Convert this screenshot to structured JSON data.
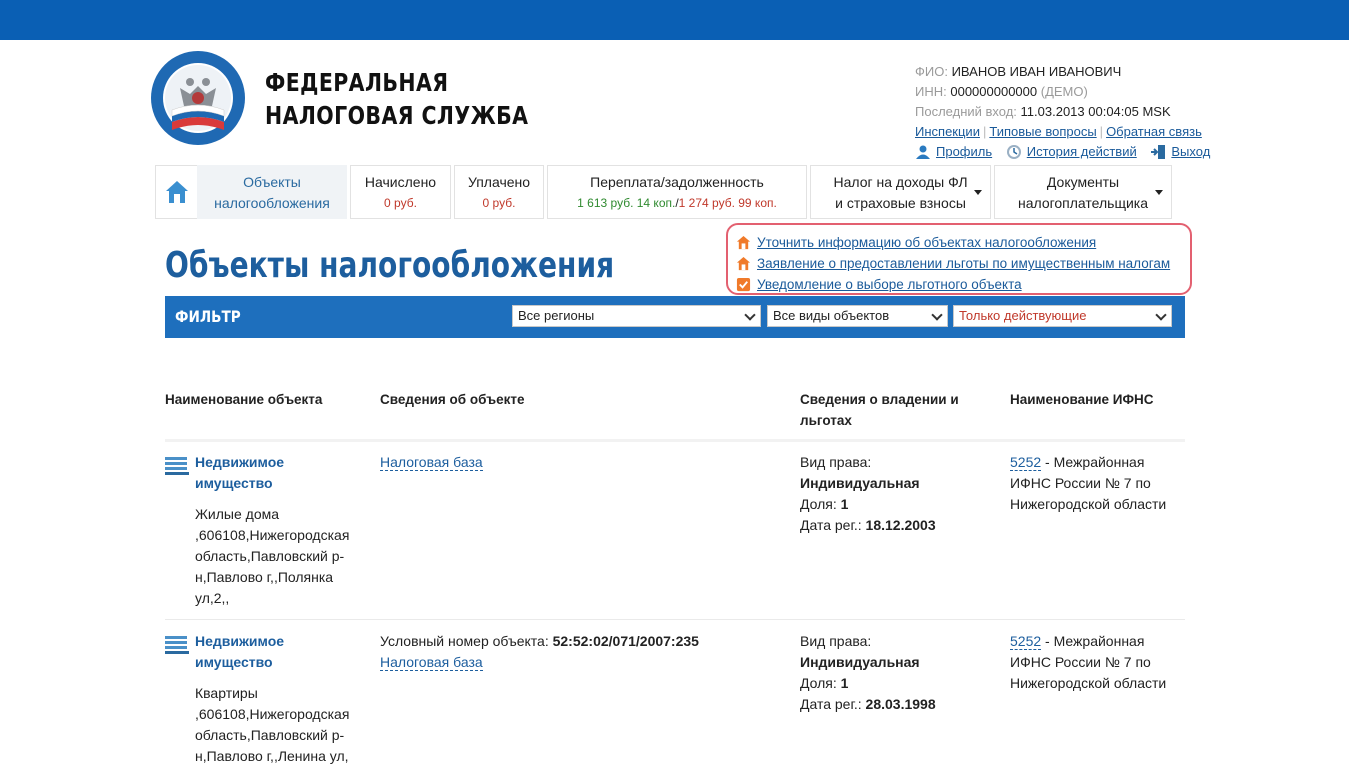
{
  "brand": {
    "line1": "ФЕДЕРАЛЬНАЯ",
    "line2": "НАЛОГОВАЯ СЛУЖБА",
    "logo_text": "ФЕДЕРАЛЬНАЯ НАЛОГОВАЯ СЛУЖБА"
  },
  "user": {
    "fio_label": "ФИО:",
    "fio": "ИВАНОВ ИВАН ИВАНОВИЧ",
    "inn_label": "ИНН:",
    "inn": "000000000000",
    "inn_note": "(ДЕМО)",
    "last_login_label": "Последний вход:",
    "last_login": "11.03.2013 00:04:05 MSK",
    "links": [
      "Инспекции",
      "Типовые вопросы",
      "Обратная связь"
    ],
    "profile": "Профиль",
    "history": "История действий",
    "logout": "Выход"
  },
  "nav": {
    "tabs": [
      {
        "label": "Объекты",
        "sub": "налогообложения"
      },
      {
        "label": "Начислено",
        "sub": "0 руб."
      },
      {
        "label": "Уплачено",
        "sub": "0 руб."
      },
      {
        "label": "Переплата/задолженность",
        "sub_green": "1 613 руб. 14 коп.",
        "sub_sep": "/",
        "sub_red": "1 274 руб. 99 коп."
      },
      {
        "label": "Налог на доходы ФЛ",
        "sub": "и страховые взносы"
      },
      {
        "label": "Документы",
        "sub": "налогоплательщика"
      }
    ]
  },
  "actions": [
    "Уточнить информацию об объектах налогообложения",
    "Заявление о предоставлении льготы по имущественным налогам",
    "Уведомление о выборе льготного объекта"
  ],
  "page_title": "Объекты налогообложения",
  "filter": {
    "label": "ФИЛЬТР",
    "region": "Все регионы",
    "object_type": "Все виды объектов",
    "status": "Только действующие"
  },
  "table": {
    "headers": [
      "Наименование объекта",
      "Сведения об объекте",
      "Сведения о владении и льготах",
      "Наименование ИФНС"
    ],
    "rows": [
      {
        "name1": "Недвижимое",
        "name2": "имущество",
        "addr": [
          "Жилые дома",
          ",606108,Нижегородская",
          "область,Павловский р-",
          "н,Павлово г,,Полянка",
          "ул,2,,"
        ],
        "info_label": "",
        "info_value": "",
        "tax_base": "Налоговая база",
        "right_label": "Вид права:",
        "right_value": "Индивидуальная",
        "share_label": "Доля:",
        "share_value": "1",
        "reg_label": "Дата рег.:",
        "reg_value": "18.12.2003",
        "ifns_code": "5252",
        "ifns_name": [
          "- Межрайонная",
          "ИФНС России № 7 по",
          "Нижегородской области"
        ]
      },
      {
        "name1": "Недвижимое",
        "name2": "имущество",
        "addr": [
          "Квартиры",
          ",606108,Нижегородская",
          "область,Павловский р-",
          "н,Павлово г,,Ленина ул,"
        ],
        "info_label": "Условный номер объекта:",
        "info_value": "52:52:02/071/2007:235",
        "tax_base": "Налоговая база",
        "right_label": "Вид права:",
        "right_value": "Индивидуальная",
        "share_label": "Доля:",
        "share_value": "1",
        "reg_label": "Дата рег.:",
        "reg_value": "28.03.1998",
        "ifns_code": "5252",
        "ifns_name": [
          "- Межрайонная",
          "ИФНС России № 7 по",
          "Нижегородской области"
        ]
      }
    ]
  },
  "colors": {
    "primary": "#0a5fb4",
    "filter_bg": "#1e6fbd",
    "link": "#1a5a9a",
    "title": "#1d5e9e",
    "debt": "#c0392b",
    "overpay": "#2f8a2f",
    "highlight_border": "#e36070"
  }
}
